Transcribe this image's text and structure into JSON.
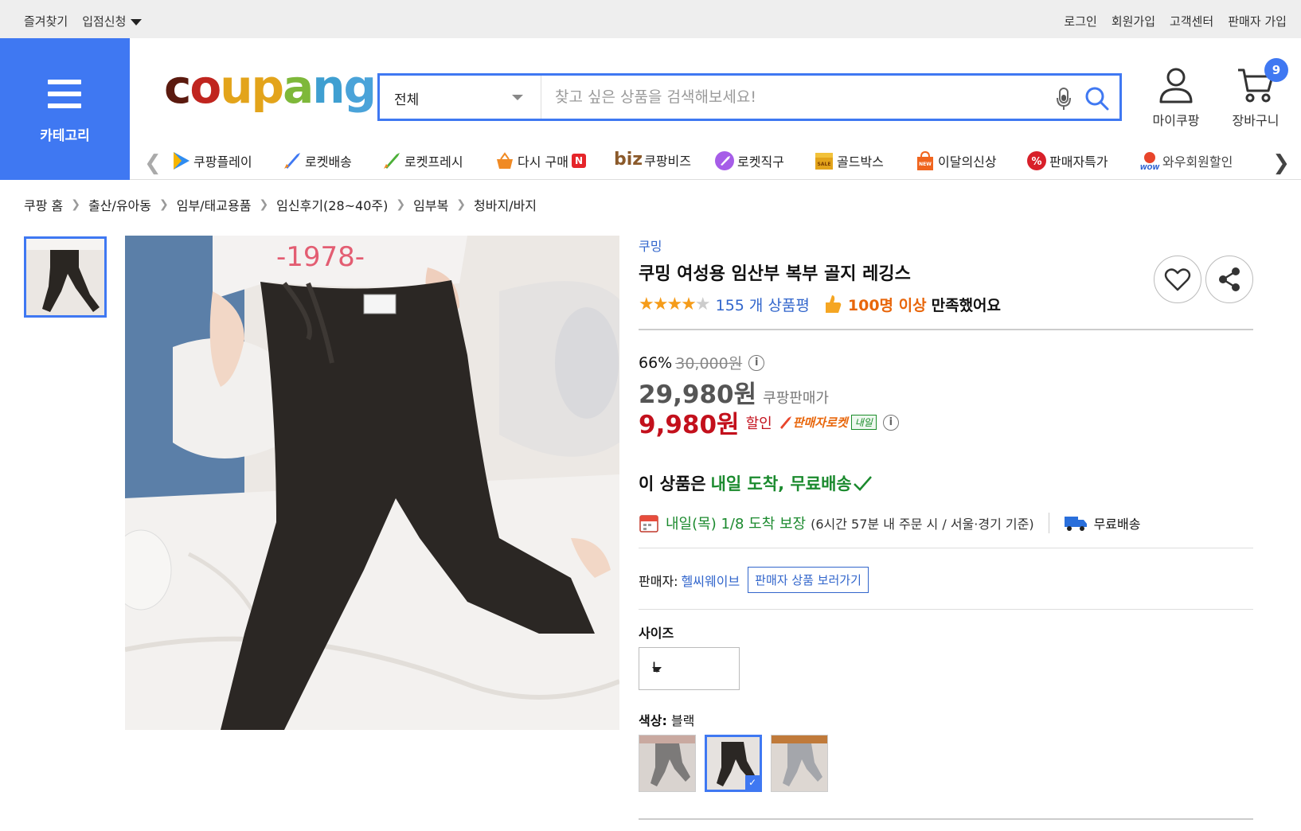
{
  "topbar": {
    "left": [
      "즐겨찾기",
      "입점신청"
    ],
    "right": [
      "로그인",
      "회원가입",
      "고객센터",
      "판매자 가입"
    ]
  },
  "category_button": "카테고리",
  "logo": {
    "c": "c",
    "o": "o",
    "u": "u",
    "p": "p",
    "a": "a",
    "n": "n",
    "g": "g"
  },
  "search": {
    "category": "전체",
    "placeholder": "찾고 싶은 상품을 검색해보세요!"
  },
  "header_actions": {
    "mycoupang": "마이쿠팡",
    "cart": "장바구니",
    "cart_count": "9"
  },
  "category_nav": [
    "쿠팡플레이",
    "로켓배송",
    "로켓프레시",
    "다시 구매",
    "쿠팡비즈",
    "로켓직구",
    "골드박스",
    "이달의신상",
    "판매자특가",
    "와우회원할인"
  ],
  "category_nav_extra": {
    "biz": "biz",
    "n_badge": "N"
  },
  "breadcrumb": [
    "쿠팡 홈",
    "출산/유아동",
    "임부/태교용품",
    "임신후기(28~40주)",
    "임부복",
    "청바지/바지"
  ],
  "product": {
    "brand": "쿠밍",
    "title": "쿠밍 여성용 임산부 복부 골지 레깅스",
    "rating_count": "155 개 상품평",
    "satisfaction_highlight": "100명 이상",
    "satisfaction_text": "만족했어요",
    "discount_rate": "66%",
    "original_price": "30,000원",
    "coupang_price": "29,980원",
    "coupang_price_label": "쿠팡판매가",
    "sale_price": "9,980원",
    "sale_label": "할인",
    "rocket_label": "판매자로켓",
    "naeil_badge": "내일",
    "arrival_prefix": "이 상품은",
    "arrival_highlight": "내일 도착, 무료배송",
    "delivery_date": "내일(목) 1/8 도착 보장",
    "delivery_cond": "(6시간 57분 내 주문 시 / 서울·경기 기준)",
    "free_shipping": "무료배송",
    "seller_label": "판매자:",
    "seller_name": "헬씨웨이브",
    "seller_button": "판매자 상품 보러가기",
    "size_label": "사이즈",
    "size_value": "L",
    "color_label": "색상:",
    "color_value": "블랙",
    "image_print": "-1978-",
    "swatch_check": "✓"
  },
  "colors": {
    "accent": "#3f78f2",
    "price_red": "#c3101c",
    "green": "#1b8a2e",
    "link": "#3266cc"
  }
}
